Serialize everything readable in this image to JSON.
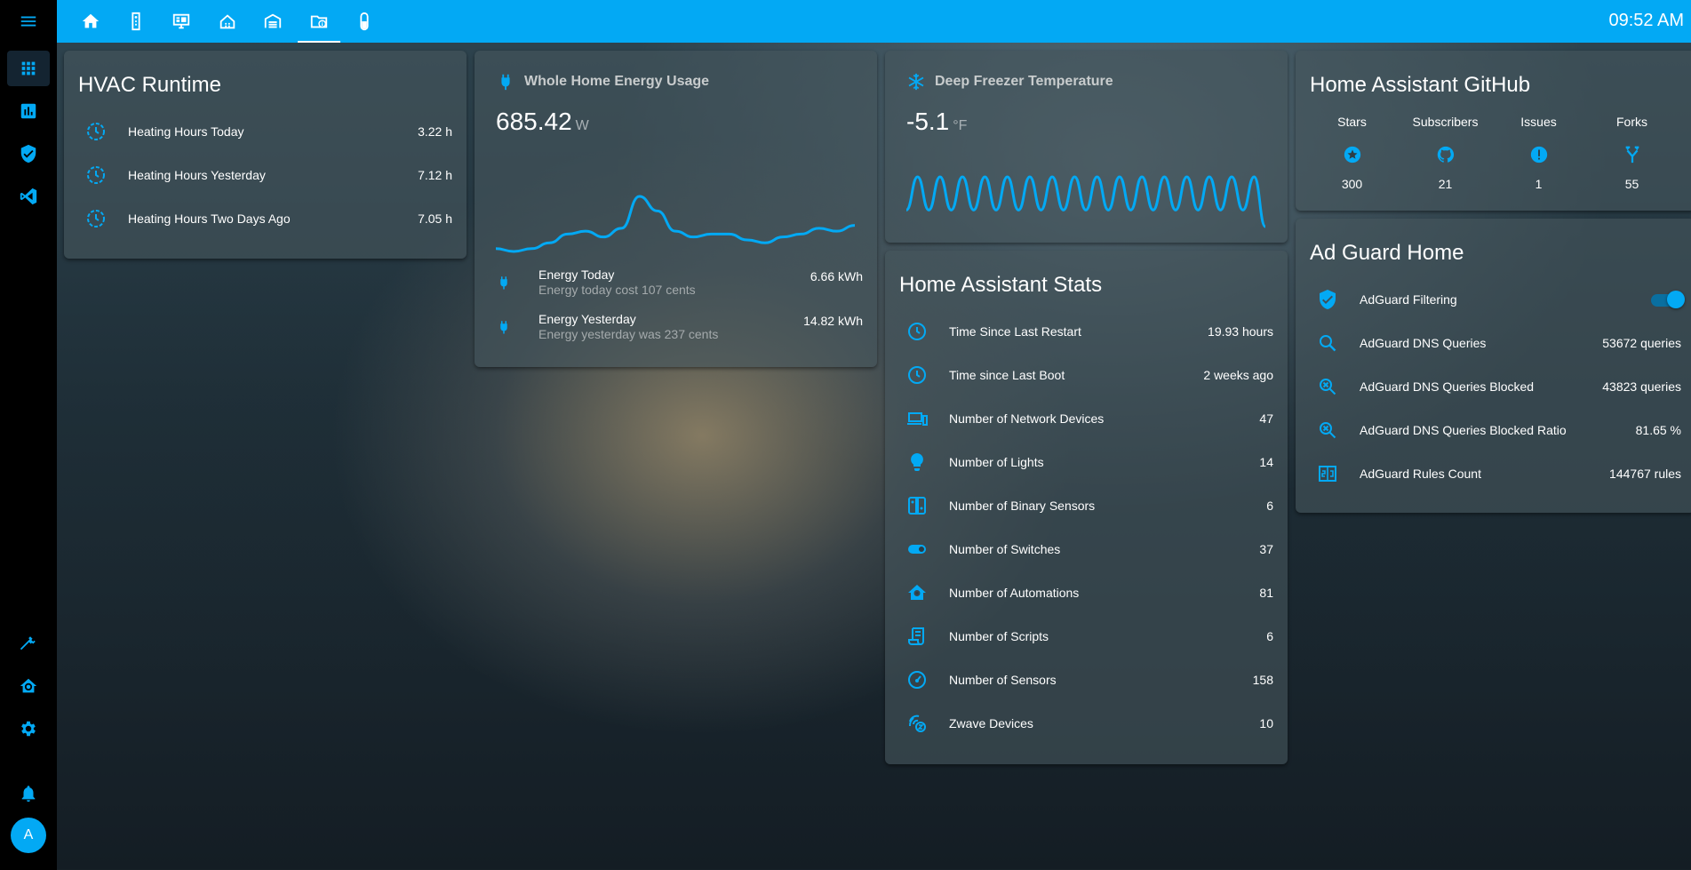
{
  "colors": {
    "accent": "#03a9f4",
    "sidebar": "#000000",
    "text": "#ffffff"
  },
  "sidebar": {
    "items": [
      {
        "icon": "menu-icon"
      },
      {
        "icon": "dashboard-grid-icon"
      },
      {
        "icon": "chart-box-icon"
      },
      {
        "icon": "shield-check-icon"
      },
      {
        "icon": "vscode-icon"
      },
      {
        "icon": "hammer-icon"
      },
      {
        "icon": "home-automation-icon"
      },
      {
        "icon": "gear-icon"
      },
      {
        "icon": "bell-icon"
      }
    ],
    "avatar": "A"
  },
  "header": {
    "tabs": [
      {
        "icon": "home-icon"
      },
      {
        "icon": "remote-icon"
      },
      {
        "icon": "monitor-dashboard-icon"
      },
      {
        "icon": "home-group-icon"
      },
      {
        "icon": "garage-icon"
      },
      {
        "icon": "folder-info-icon",
        "active": true
      },
      {
        "icon": "capsule-icon"
      }
    ],
    "clock": "09:52 AM"
  },
  "hvac": {
    "title": "HVAC Runtime",
    "rows": [
      {
        "name": "Heating Hours Today",
        "value": "3.22 h"
      },
      {
        "name": "Heating Hours Yesterday",
        "value": "7.12 h"
      },
      {
        "name": "Heating Hours Two Days Ago",
        "value": "7.05 h"
      }
    ]
  },
  "energy": {
    "title": "Whole Home Energy Usage",
    "value": "685.42",
    "unit": "W",
    "history": [
      50,
      49,
      50,
      52,
      55,
      56,
      54,
      57,
      68,
      63,
      56,
      54,
      55,
      55,
      53,
      52,
      54,
      55,
      57,
      56,
      58
    ],
    "rows": [
      {
        "name": "Energy Today",
        "secondary": "Energy today cost 107 cents",
        "value": "6.66 kWh"
      },
      {
        "name": "Energy Yesterday",
        "secondary": "Energy yesterday was 237 cents",
        "value": "14.82 kWh"
      }
    ]
  },
  "freezer": {
    "title": "Deep Freezer Temperature",
    "value": "-5.1",
    "unit": "°F",
    "history": [
      -5.4,
      -4.6,
      -5.4,
      -4.6,
      -5.4,
      -4.6,
      -5.4,
      -4.6,
      -5.4,
      -4.6,
      -5.4,
      -4.6,
      -5.4,
      -4.6,
      -5.4,
      -4.6,
      -5.4,
      -4.6,
      -5.4,
      -4.6,
      -5.4,
      -4.6,
      -5.4,
      -4.6,
      -5.4,
      -4.6,
      -5.4,
      -4.6,
      -5.4,
      -4.6,
      -5.4,
      -4.6,
      -5.8
    ]
  },
  "ha_stats": {
    "title": "Home Assistant Stats",
    "rows": [
      {
        "icon": "clock-icon",
        "name": "Time Since Last Restart",
        "value": "19.93 hours"
      },
      {
        "icon": "clock-icon",
        "name": "Time since Last Boot",
        "value": "2 weeks ago"
      },
      {
        "icon": "devices-icon",
        "name": "Number of Network Devices",
        "value": "47"
      },
      {
        "icon": "lightbulb-icon",
        "name": "Number of Lights",
        "value": "14"
      },
      {
        "icon": "nintendo-switch-icon",
        "name": "Number of Binary Sensors",
        "value": "6"
      },
      {
        "icon": "toggle-switch-icon",
        "name": "Number of Switches",
        "value": "37"
      },
      {
        "icon": "home-automation-icon",
        "name": "Number of Automations",
        "value": "81"
      },
      {
        "icon": "script-icon",
        "name": "Number of Scripts",
        "value": "6"
      },
      {
        "icon": "gauge-icon",
        "name": "Number of Sensors",
        "value": "158"
      },
      {
        "icon": "zwave-icon",
        "name": "Zwave Devices",
        "value": "10"
      }
    ]
  },
  "github": {
    "title": "Home Assistant GitHub",
    "cols": [
      {
        "label": "Stars",
        "icon": "star-circle-icon",
        "value": "300"
      },
      {
        "label": "Subscribers",
        "icon": "github-icon",
        "value": "21"
      },
      {
        "label": "Issues",
        "icon": "alert-circle-icon",
        "value": "1"
      },
      {
        "label": "Forks",
        "icon": "fork-icon",
        "value": "55"
      }
    ]
  },
  "adguard": {
    "title": "Ad Guard Home",
    "toggle_row": {
      "name": "AdGuard Filtering",
      "state": "on"
    },
    "rows": [
      {
        "icon": "magnify-icon",
        "name": "AdGuard DNS Queries",
        "value": "53672 queries"
      },
      {
        "icon": "magnify-close-icon",
        "name": "AdGuard DNS Queries Blocked",
        "value": "43823 queries"
      },
      {
        "icon": "magnify-close-icon",
        "name": "AdGuard DNS Queries Blocked Ratio",
        "value": "81.65 %"
      },
      {
        "icon": "counter-icon",
        "name": "AdGuard Rules Count",
        "value": "144767 rules"
      }
    ]
  }
}
